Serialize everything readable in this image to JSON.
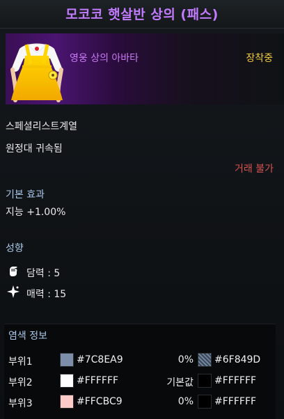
{
  "title": "모코코 햇살반 상의 (패스)",
  "item": {
    "subtitle": "영웅 상의 아바타",
    "status": "장착중",
    "class_req": "스페셜리스트계열",
    "bind": "원정대 귀속됨",
    "trade": "거래 불가"
  },
  "base_effect": {
    "header": "기본 효과",
    "stat": "지능 +1.00%"
  },
  "tendency": {
    "header": "성향",
    "items": [
      {
        "text": "담력 : 5",
        "icon": "fist-icon"
      },
      {
        "text": "매력 : 15",
        "icon": "sparkle-icon"
      }
    ]
  },
  "dye": {
    "header": "염색 정보",
    "rows": [
      {
        "part": "부위1",
        "color": "#7C8EA9",
        "hex": "#7C8EA9",
        "mid": "0%",
        "pattern": true,
        "hex2": "#6F849D"
      },
      {
        "part": "부위2",
        "color": "#FFFFFF",
        "hex": "#FFFFFF",
        "mid": "기본값",
        "pattern": false,
        "hex2": "#FFFFFF"
      },
      {
        "part": "부위3",
        "color": "#FFCBC9",
        "hex": "#FFCBC9",
        "mid": "0%",
        "pattern": false,
        "hex2": "#FFFFFF"
      }
    ]
  },
  "colors": {
    "title": "#c27bff",
    "subtitle": "#c97af5",
    "equipped": "#f3cc3b",
    "section": "#a9c7ea",
    "trade": "#d9534f"
  }
}
